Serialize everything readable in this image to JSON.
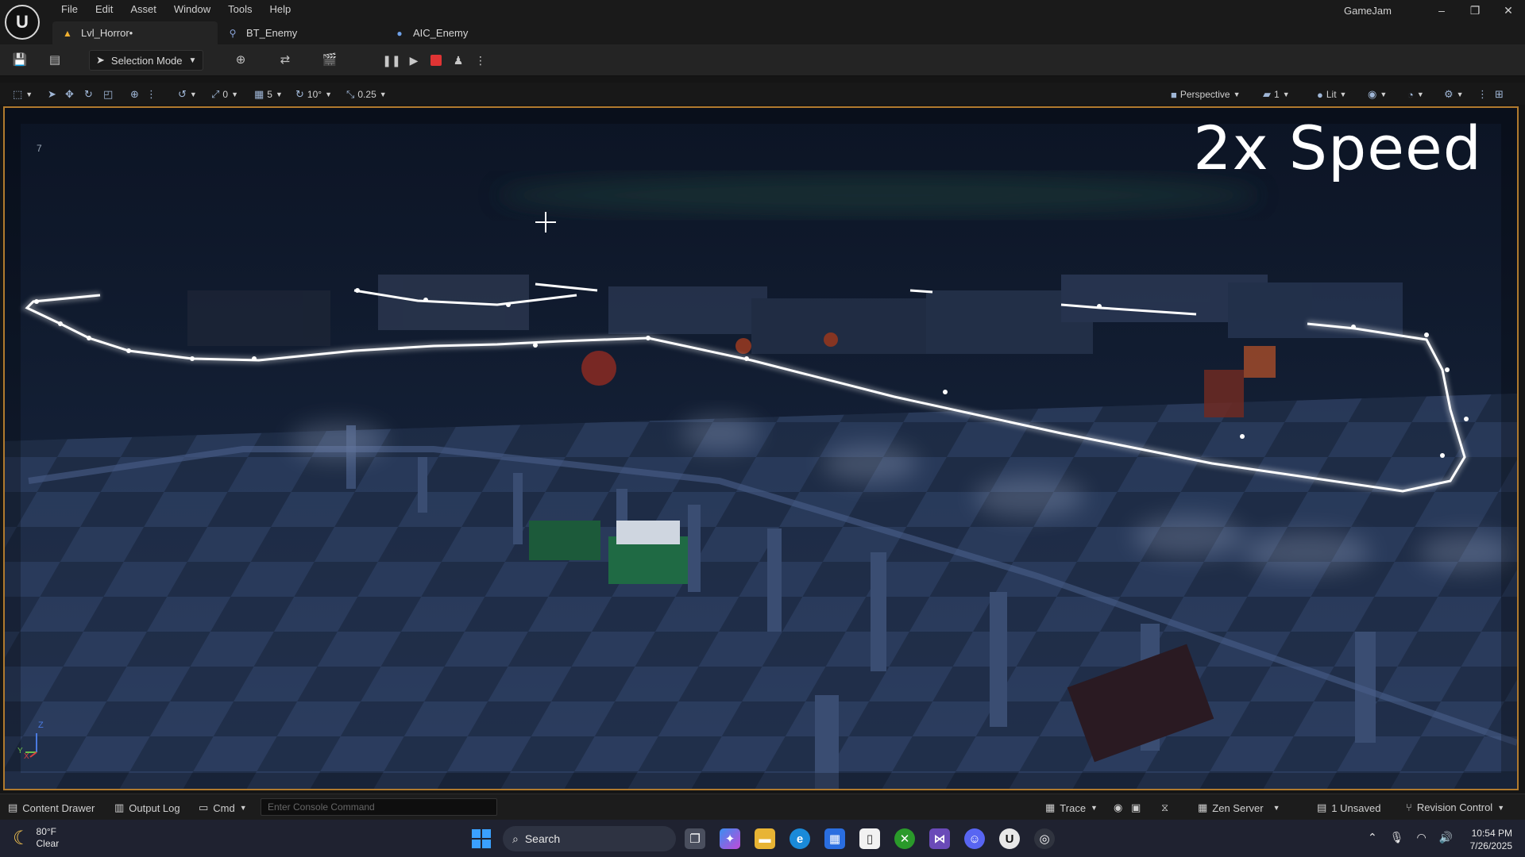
{
  "menu": [
    "File",
    "Edit",
    "Asset",
    "Window",
    "Tools",
    "Help"
  ],
  "tabs": [
    {
      "label": "Lvl_Horror•",
      "icon": "level-icon",
      "active": true
    },
    {
      "label": "BT_Enemy",
      "icon": "behavior-tree-icon",
      "active": false
    },
    {
      "label": "AIC_Enemy",
      "icon": "ai-controller-icon",
      "active": false
    }
  ],
  "app_name": "GameJam",
  "toolbar": {
    "selection_mode": "Selection Mode"
  },
  "viewport_toolbar": {
    "rotation_snap": "0",
    "grid_snap": "5",
    "angle_snap": "10°",
    "scale_snap": "0.25",
    "perspective": "Perspective",
    "camera_speed": "1",
    "view_mode": "Lit"
  },
  "viewport": {
    "overlay_text": "2x Speed",
    "fps_stat": "7",
    "axis_z": "Z",
    "axis_y": "Y",
    "axis_x": "X"
  },
  "statusbar": {
    "content_drawer": "Content Drawer",
    "output_log": "Output Log",
    "cmd": "Cmd",
    "console_placeholder": "Enter Console Command",
    "trace": "Trace",
    "zen_server": "Zen Server",
    "unsaved": "1 Unsaved",
    "revision_control": "Revision Control"
  },
  "taskbar": {
    "temperature": "80°F",
    "weather": "Clear",
    "search": "Search",
    "time": "10:54 PM",
    "date": "7/26/2025"
  },
  "colors": {
    "viewport_border": "#b07a2e",
    "stop_button": "#e03434",
    "spline": "#ffffff"
  }
}
